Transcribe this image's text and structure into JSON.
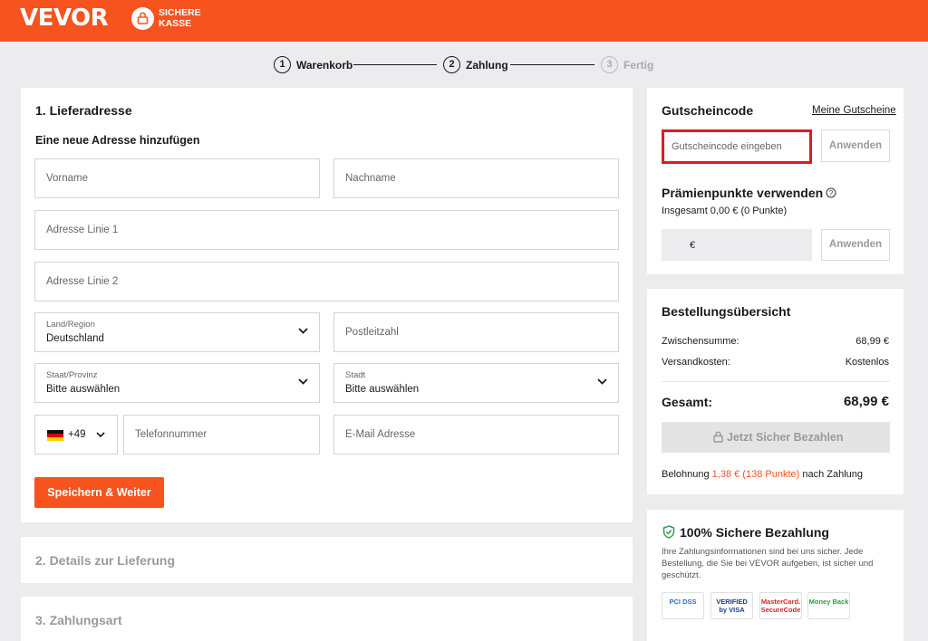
{
  "header": {
    "brand": "VEVOR",
    "secure_line1": "SICHERE",
    "secure_line2": "KASSE"
  },
  "steps": [
    {
      "num": "1",
      "label": "Warenkorb"
    },
    {
      "num": "2",
      "label": "Zahlung"
    },
    {
      "num": "3",
      "label": "Fertig"
    }
  ],
  "address": {
    "title": "1. Lieferadresse",
    "subtitle": "Eine neue Adresse hinzufügen",
    "first_name": "Vorname",
    "last_name": "Nachname",
    "address1": "Adresse Linie 1",
    "address2": "Adresse Linie 2",
    "country_label": "Land/Region",
    "country_value": "Deutschland",
    "postal": "Postleitzahl",
    "state_label": "Staat/Provinz",
    "state_value": "Bitte auswählen",
    "city_label": "Stadt",
    "city_value": "Bitte auswählen",
    "phone_code": "+49",
    "phone": "Telefonnummer",
    "email": "E-Mail Adresse",
    "save_button": "Speichern & Weiter"
  },
  "delivery_title": "2. Details zur Lieferung",
  "payment_title": "3. Zahlungsart",
  "coupon": {
    "title": "Gutscheincode",
    "my_coupons": "Meine Gutscheine",
    "placeholder": "Gutscheincode eingeben",
    "apply": "Anwenden",
    "points_title": "Prämienpunkte verwenden",
    "points_total": "Insgesamt 0,00 € (0 Punkte)",
    "points_currency": "€",
    "points_apply": "Anwenden"
  },
  "summary": {
    "title": "Bestellungsübersicht",
    "subtotal_label": "Zwischensumme:",
    "subtotal_value": "68,99 €",
    "shipping_label": "Versandkosten:",
    "shipping_value": "Kostenlos",
    "total_label": "Gesamt:",
    "total_value": "68,99 €",
    "pay_button": "Jetzt Sicher Bezahlen",
    "reward_prefix": "Belohnung",
    "reward_value": "1,38 € (138 Punkte)",
    "reward_suffix": "nach Zahlung"
  },
  "secure": {
    "title": "100% Sichere Bezahlung",
    "text": "Ihre Zahlungsinformationen sind bei uns sicher. Jede Bestellung, die Sie bei VEVOR aufgeben, ist sicher und geschützt.",
    "badge_pci": "PCI DSS",
    "badge_visa": "VERIFIED by VISA",
    "badge_mc": "MasterCard. SecureCode",
    "badge_money": "Money Back"
  },
  "colors": {
    "brand": "#f6531f",
    "highlight_border": "#e11c1c",
    "reward": "#f6531f"
  }
}
